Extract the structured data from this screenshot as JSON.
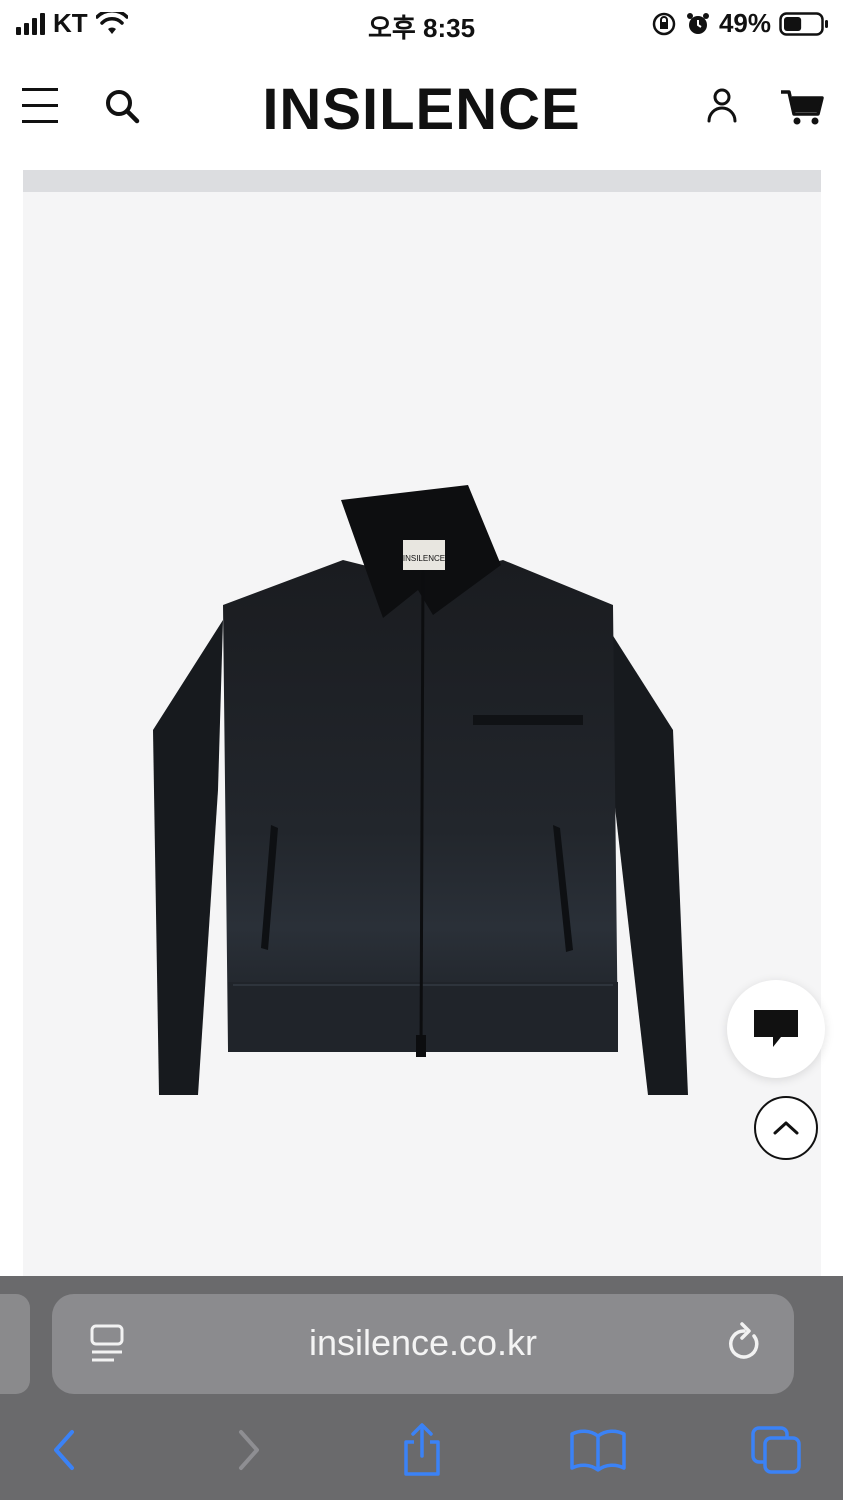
{
  "status_bar": {
    "carrier": "KT",
    "time": "오후 8:35",
    "battery": "49%",
    "battery_level": 0.49
  },
  "header": {
    "logo": "INSILENCE",
    "icons": [
      "menu-icon",
      "search-icon",
      "user-icon",
      "cart-icon"
    ]
  },
  "product": {
    "image_alt": "jacket-product-image",
    "label_text": "INSILENCE"
  },
  "floating": {
    "chat_icon": "chat-icon",
    "scroll_top_icon": "chevron-up-icon"
  },
  "browser": {
    "url": "insilence.co.kr",
    "toolbar_icons": [
      "back-icon",
      "forward-icon",
      "share-icon",
      "bookmarks-icon",
      "tabs-icon"
    ]
  },
  "colors": {
    "accent_blue": "#3b82f6",
    "toolbar_bg": "#6a6a6c",
    "product_bg": "#f5f5f6"
  }
}
